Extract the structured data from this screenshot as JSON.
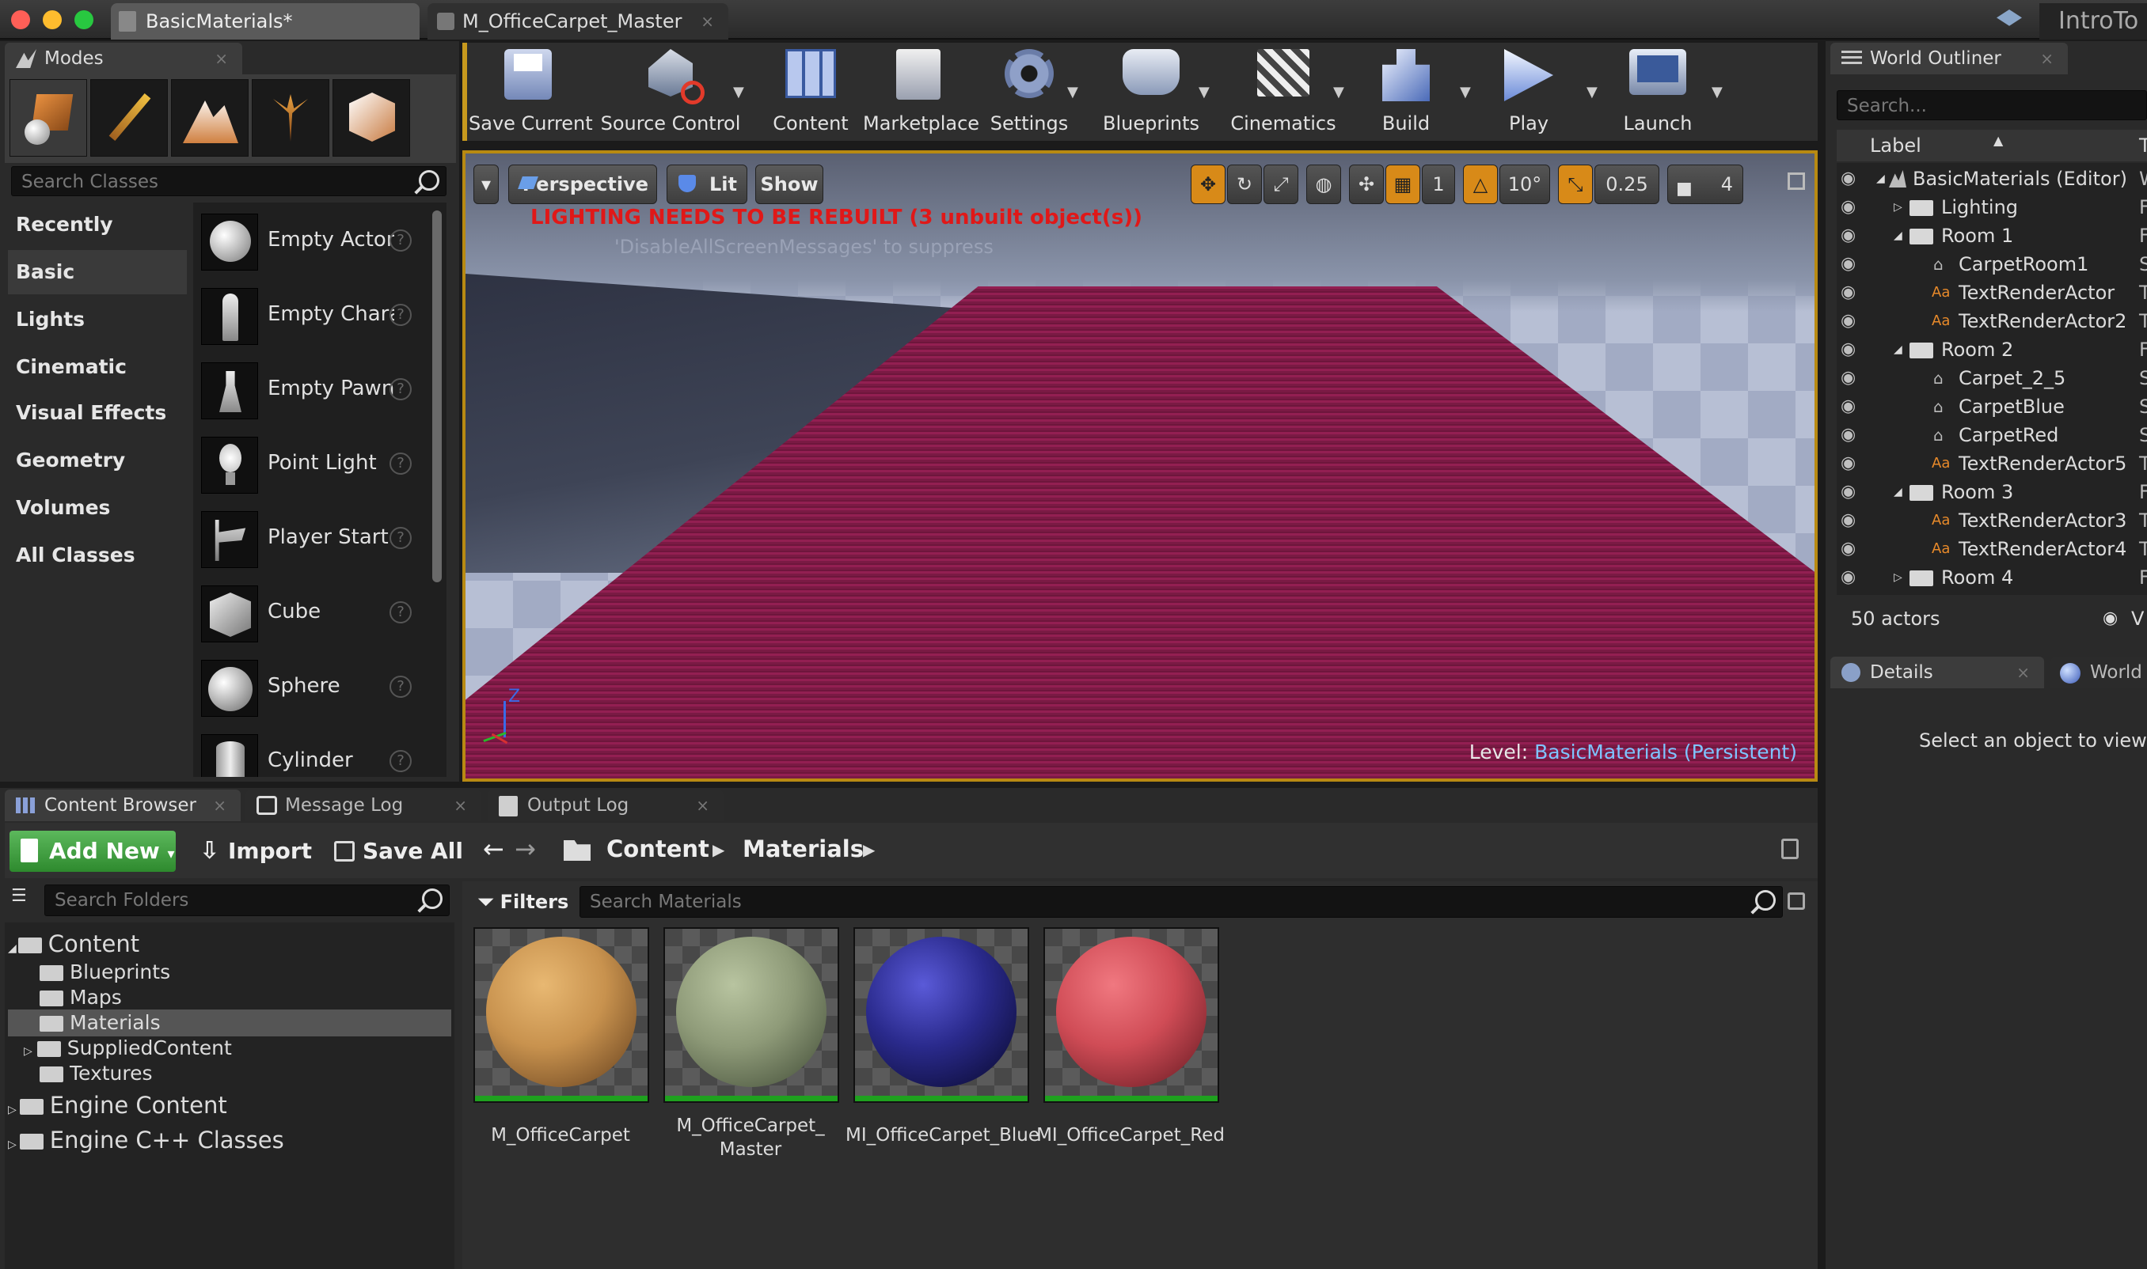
{
  "window": {
    "tabs": [
      {
        "label": "BasicMaterials*"
      },
      {
        "label": "M_OfficeCarpet_Master"
      }
    ],
    "project_name": "IntroTo",
    "close_glyph": "×"
  },
  "modes": {
    "panel_tab": "Modes",
    "search_placeholder": "Search Classes",
    "mode_icons": [
      "place-mode-icon",
      "paint-mode-icon",
      "landscape-mode-icon",
      "foliage-mode-icon",
      "geometry-mode-icon"
    ],
    "categories": [
      "Recently Placed",
      "Basic",
      "Lights",
      "Cinematic",
      "Visual Effects",
      "Geometry",
      "Volumes",
      "All Classes"
    ],
    "selected_category": "Basic",
    "items": [
      "Empty Actor",
      "Empty Character",
      "Empty Pawn",
      "Point Light",
      "Player Start",
      "Cube",
      "Sphere",
      "Cylinder"
    ],
    "help_glyph": "?"
  },
  "toolbar": {
    "buttons": [
      {
        "label": "Save Current",
        "icon": "save-icon"
      },
      {
        "label": "Source Control",
        "icon": "source-control-icon"
      },
      {
        "label": "Content",
        "icon": "content-icon"
      },
      {
        "label": "Marketplace",
        "icon": "marketplace-icon"
      },
      {
        "label": "Settings",
        "icon": "settings-icon"
      },
      {
        "label": "Blueprints",
        "icon": "blueprints-icon"
      },
      {
        "label": "Cinematics",
        "icon": "cinematics-icon"
      },
      {
        "label": "Build",
        "icon": "build-icon"
      },
      {
        "label": "Play",
        "icon": "play-icon"
      },
      {
        "label": "Launch",
        "icon": "launch-icon"
      }
    ]
  },
  "viewport": {
    "perspective_label": "Perspective",
    "lit_label": "Lit",
    "show_label": "Show",
    "grid_snap": "1",
    "rotation_snap": "10°",
    "scale_snap": "0.25",
    "camera_speed": "4",
    "warning": "LIGHTING NEEDS TO BE REBUILT (3 unbuilt object(s))",
    "suppress_hint": "'DisableAllScreenMessages' to suppress",
    "level_prefix": "Level:",
    "level_name": "BasicMaterials (Persistent)",
    "axis_label": "Z",
    "colors": {
      "warning": "#e01818",
      "level_name": "#7fc4ff",
      "carpet": "#8c1f4f"
    }
  },
  "outliner": {
    "panel_tab": "World Outliner",
    "search_placeholder": "Search...",
    "column_label": "Label",
    "column_type": "T",
    "rows": [
      {
        "label": "BasicMaterials (Editor)",
        "type": "W"
      },
      {
        "label": "Lighting",
        "type": "F"
      },
      {
        "label": "Room 1",
        "type": "F"
      },
      {
        "label": "CarpetRoom1",
        "type": "S"
      },
      {
        "label": "TextRenderActor",
        "type": "T"
      },
      {
        "label": "TextRenderActor2",
        "type": "T"
      },
      {
        "label": "Room 2",
        "type": "F"
      },
      {
        "label": "Carpet_2_5",
        "type": "S"
      },
      {
        "label": "CarpetBlue",
        "type": "S"
      },
      {
        "label": "CarpetRed",
        "type": "S"
      },
      {
        "label": "TextRenderActor5",
        "type": "T"
      },
      {
        "label": "Room 3",
        "type": "F"
      },
      {
        "label": "TextRenderActor3",
        "type": "T"
      },
      {
        "label": "TextRenderActor4",
        "type": "T"
      },
      {
        "label": "Room 4",
        "type": "F"
      }
    ],
    "actor_count": "50 actors",
    "view_options": "V"
  },
  "details": {
    "tab_details": "Details",
    "tab_world": "World",
    "hint": "Select an object to view det"
  },
  "bottom_tabs": {
    "content_browser": "Content Browser",
    "message_log": "Message Log",
    "output_log": "Output Log"
  },
  "content_browser": {
    "add_new": "Add New",
    "import": "Import",
    "save_all": "Save All",
    "path": [
      "Content",
      "Materials"
    ],
    "folder_search_placeholder": "Search Folders",
    "filters_label": "Filters",
    "asset_search_placeholder": "Search Materials",
    "tree": [
      {
        "label": "Content"
      },
      {
        "label": "Blueprints"
      },
      {
        "label": "Maps"
      },
      {
        "label": "Materials"
      },
      {
        "label": "SuppliedContent"
      },
      {
        "label": "Textures"
      },
      {
        "label": "Engine Content"
      },
      {
        "label": "Engine C++ Classes"
      }
    ],
    "assets": [
      {
        "name": "M_OfficeCarpet",
        "color": "#c8924e"
      },
      {
        "name": "M_OfficeCarpet_ Master",
        "color": "#8e9a78"
      },
      {
        "name": "MI_OfficeCarpet_Blue",
        "color": "#2a2a8c"
      },
      {
        "name": "MI_OfficeCarpet_Red",
        "color": "#d04c56"
      }
    ]
  }
}
